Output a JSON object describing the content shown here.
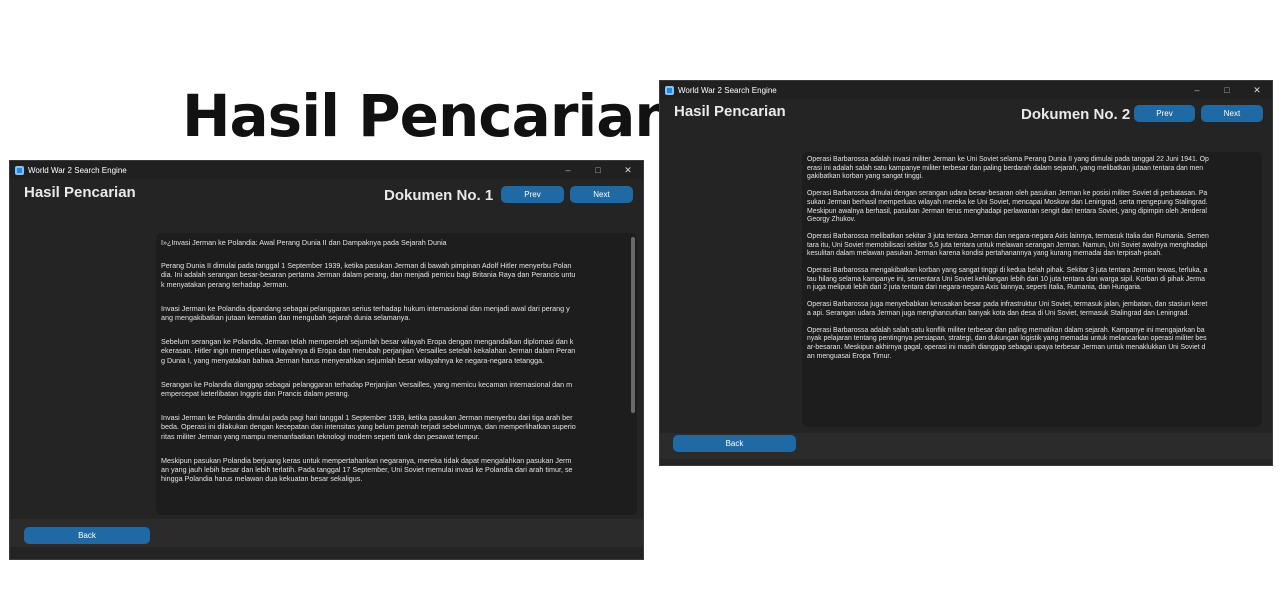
{
  "page_title": "Hasil Pencarian",
  "window1": {
    "app_title": "World War 2 Search Engine",
    "controls": {
      "minimize": "–",
      "maximize": "□",
      "close": "✕"
    },
    "heading": "Hasil Pencarian",
    "doc_label": "Dokumen No. 1",
    "prev_label": "Prev",
    "next_label": "Next",
    "back_label": "Back",
    "paragraphs": [
      "ï»¿Invasi Jerman ke Polandia: Awal Perang Dunia II dan Dampaknya pada Sejarah Dunia",
      "Perang Dunia II dimulai pada tanggal 1 September 1939, ketika pasukan Jerman di bawah pimpinan Adolf Hitler menyerbu Polan\ndia. Ini adalah serangan besar-besaran pertama Jerman dalam perang, dan menjadi pemicu bagi Britania Raya dan Perancis untu\nk menyatakan perang terhadap Jerman.",
      "Invasi Jerman ke Polandia dipandang sebagai pelanggaran serius terhadap hukum internasional dan menjadi awal dari perang y\nang mengakibatkan jutaan kematian dan mengubah sejarah dunia selamanya.",
      "Sebelum serangan ke Polandia, Jerman telah memperoleh sejumlah besar wilayah Eropa dengan mengandalkan diplomasi dan k\nekerasan. Hitler ingin memperluas wilayahnya di Eropa dan merubah perjanjian Versailles setelah kekalahan Jerman dalam Peran\ng Dunia I, yang menyatakan bahwa Jerman harus menyerahkan sejumlah besar wilayahnya ke negara-negara tetangga.",
      "Serangan ke Polandia dianggap sebagai pelanggaran terhadap Perjanjian Versailles, yang memicu kecaman internasional dan m\nempercepat keterlibatan Inggris dan Prancis dalam perang.",
      "Invasi Jerman ke Polandia dimulai pada pagi hari tanggal 1 September 1939, ketika pasukan Jerman menyerbu dari tiga arah ber\nbeda. Operasi ini dilakukan dengan kecepatan dan intensitas yang belum pernah terjadi sebelumnya, dan memperlihatkan superio\nritas militer Jerman yang mampu memanfaatkan teknologi modern seperti tank dan pesawat tempur.",
      "Meskipun pasukan Polandia berjuang keras untuk mempertahankan negaranya, mereka tidak dapat mengalahkan pasukan Jerm\nan yang jauh lebih besar dan lebih terlatih. Pada tanggal 17 September, Uni Soviet memulai invasi ke Polandia dari arah timur, se\nhingga Polandia harus melawan dua kekuatan besar sekaligus."
    ]
  },
  "window2": {
    "app_title": "World War 2 Search Engine",
    "controls": {
      "minimize": "–",
      "maximize": "□",
      "close": "✕"
    },
    "heading": "Hasil Pencarian",
    "doc_label": "Dokumen No. 2",
    "prev_label": "Prev",
    "next_label": "Next",
    "back_label": "Back",
    "paragraphs": [
      "Operasi Barbarossa adalah invasi militer Jerman ke Uni Soviet selama Perang Dunia II yang dimulai pada tanggal 22 Juni 1941. Op\nerasi ini adalah salah satu kampanye militer terbesar dan paling berdarah dalam sejarah, yang melibatkan jutaan tentara dan men\ngakibatkan korban yang sangat tinggi.",
      "Operasi Barbarossa dimulai dengan serangan udara besar-besaran oleh pasukan Jerman ke posisi militer Soviet di perbatasan. Pa\nsukan Jerman berhasil memperluas wilayah mereka ke Uni Soviet, mencapai Moskow dan Leningrad, serta mengepung Stalingrad.\nMeskipun awalnya berhasil, pasukan Jerman terus menghadapi perlawanan sengit dari tentara Soviet, yang dipimpin oleh Jenderal\nGeorgy Zhukov.",
      "Operasi Barbarossa melibatkan sekitar 3 juta tentara Jerman dan negara-negara Axis lainnya, termasuk Italia dan Rumania. Semen\ntara itu, Uni Soviet memobilisasi sekitar 5,5 juta tentara untuk melawan serangan Jerman. Namun, Uni Soviet awalnya menghadapi\nkesulitan dalam melawan pasukan Jerman karena kondisi pertahanannya yang kurang memadai dan terpisah-pisah.",
      "Operasi Barbarossa mengakibatkan korban yang sangat tinggi di kedua belah pihak. Sekitar 3 juta tentara Jerman tewas, terluka, a\ntau hilang selama kampanye ini, sementara Uni Soviet kehilangan lebih dari 10 juta tentara dan warga sipil. Korban di pihak Jerma\nn juga meliputi lebih dari 2 juta tentara dari negara-negara Axis lainnya, seperti Italia, Rumania, dan Hungaria.",
      "Operasi Barbarossa juga menyebabkan kerusakan besar pada infrastruktur Uni Soviet, termasuk jalan, jembatan, dan stasiun keret\na api. Serangan udara Jerman juga menghancurkan banyak kota dan desa di Uni Soviet, termasuk Stalingrad dan Leningrad.",
      "Operasi Barbarossa adalah salah satu konflik militer terbesar dan paling mematikan dalam sejarah. Kampanye ini mengajarkan ba\nnyak pelajaran tentang pentingnya persiapan, strategi, dan dukungan logistik yang memadai untuk melancarkan operasi militer bes\nar-besaran. Meskipun akhirnya gagal, operasi ini masih dianggap sebagai upaya terbesar Jerman untuk menaklukkan Uni Soviet d\nan menguasai Eropa Timur."
    ]
  }
}
